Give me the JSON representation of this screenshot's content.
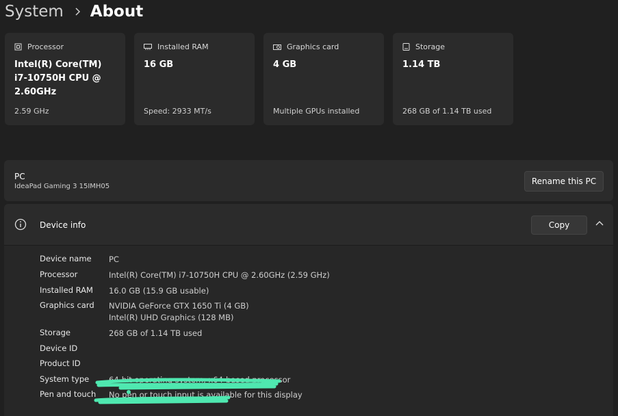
{
  "header": {
    "parent": "System",
    "current": "About"
  },
  "cards": [
    {
      "label": "Processor",
      "value": "Intel(R) Core(TM) i7-10750H CPU @ 2.60GHz",
      "sub": "2.59 GHz",
      "icon": "processor-icon"
    },
    {
      "label": "Installed RAM",
      "value": "16 GB",
      "sub": "Speed: 2933 MT/s",
      "icon": "ram-icon"
    },
    {
      "label": "Graphics card",
      "value": "4 GB",
      "sub": "Multiple GPUs installed",
      "icon": "graphics-card-icon"
    },
    {
      "label": "Storage",
      "value": "1.14 TB",
      "sub": "268 GB of 1.14 TB used",
      "icon": "storage-icon"
    }
  ],
  "pc": {
    "name": "PC",
    "model": "IdeaPad Gaming 3 15IMH05",
    "rename_label": "Rename this PC"
  },
  "device_info": {
    "title": "Device info",
    "copy_label": "Copy",
    "rows": [
      {
        "key": "Device name",
        "value": "PC"
      },
      {
        "key": "Processor",
        "value": "Intel(R) Core(TM) i7-10750H CPU @ 2.60GHz (2.59 GHz)"
      },
      {
        "key": "Installed RAM",
        "value": "16.0 GB (15.9 GB usable)"
      },
      {
        "key": "Graphics card",
        "value": "NVIDIA GeForce GTX 1650 Ti (4 GB)",
        "value2": "Intel(R) UHD Graphics (128 MB)"
      },
      {
        "key": "Storage",
        "value": "268 GB of 1.14 TB used"
      },
      {
        "key": "Device ID",
        "value": ""
      },
      {
        "key": "Product ID",
        "value": ""
      },
      {
        "key": "System type",
        "value": "64-bit operating system, x64-based processor"
      },
      {
        "key": "Pen and touch",
        "value": "No pen or touch input is available for this display"
      }
    ]
  },
  "colors": {
    "background": "#202020",
    "panel": "#2b2b2b",
    "redaction": "#4fe8b0"
  }
}
